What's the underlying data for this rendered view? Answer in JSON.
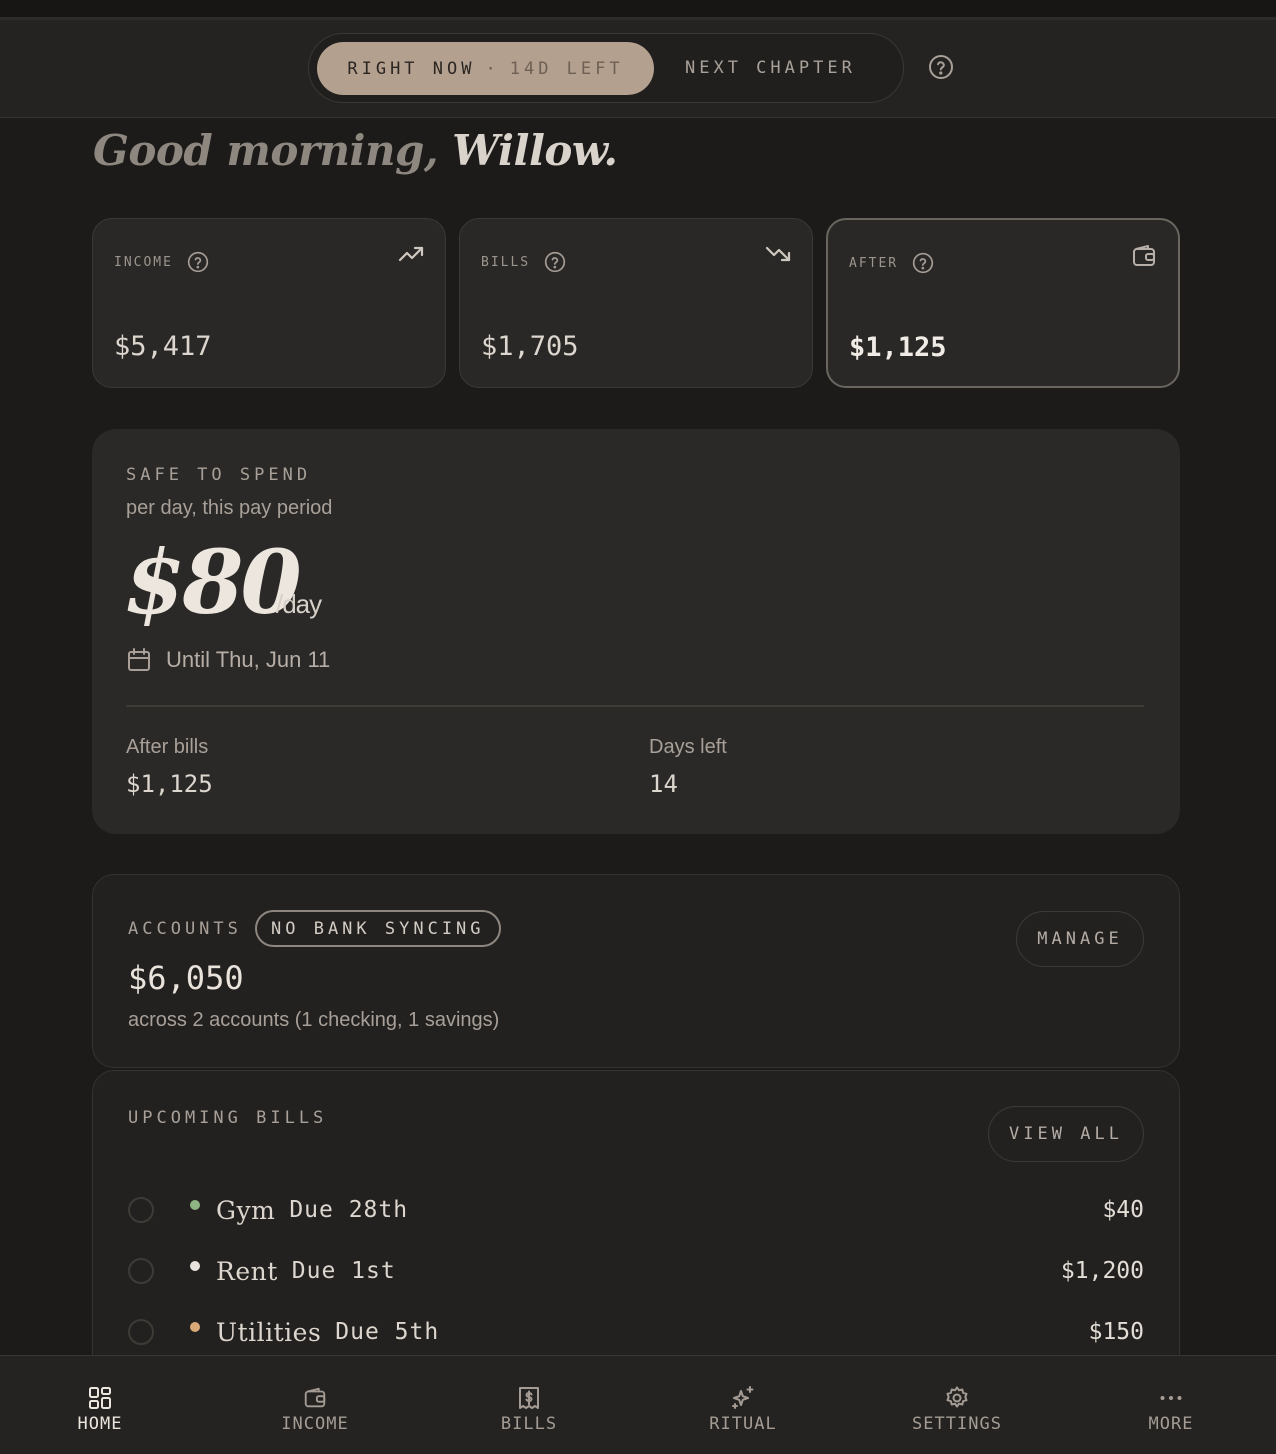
{
  "header": {
    "segment_active": "RIGHT NOW",
    "segment_separator": "·",
    "segment_days_left": "14D LEFT",
    "segment_next": "NEXT CHAPTER"
  },
  "greeting": {
    "prefix": "Good morning,",
    "name": "Willow."
  },
  "stats": [
    {
      "label": "INCOME",
      "value": "$5,417",
      "icon": "trend-up-icon"
    },
    {
      "label": "BILLS",
      "value": "$1,705",
      "icon": "trend-down-icon"
    },
    {
      "label": "AFTER",
      "value": "$1,125",
      "icon": "wallet-icon"
    }
  ],
  "safe": {
    "kicker": "SAFE TO SPEND",
    "subtitle": "per day, this pay period",
    "amount": "$80",
    "unit": "/day",
    "until": "Until Thu, Jun 11",
    "after_bills_label": "After bills",
    "after_bills_value": "$1,125",
    "days_left_label": "Days left",
    "days_left_value": "14"
  },
  "accounts": {
    "kicker": "ACCOUNTS",
    "badge": "NO BANK SYNCING",
    "total": "$6,050",
    "description": "across 2 accounts (1 checking, 1 savings)",
    "manage_label": "MANAGE"
  },
  "bills": {
    "kicker": "UPCOMING BILLS",
    "view_all_label": "VIEW ALL",
    "items": [
      {
        "name": "Gym",
        "due": "Due 28th",
        "amount": "$40",
        "dot_color": "#8fb584"
      },
      {
        "name": "Rent",
        "due": "Due 1st",
        "amount": "$1,200",
        "dot_color": "#e8e3dd"
      },
      {
        "name": "Utilities",
        "due": "Due 5th",
        "amount": "$150",
        "dot_color": "#d9a977"
      }
    ]
  },
  "nav": [
    {
      "label": "HOME",
      "icon": "grid-icon",
      "active": true
    },
    {
      "label": "INCOME",
      "icon": "wallet-icon",
      "active": false
    },
    {
      "label": "BILLS",
      "icon": "receipt-icon",
      "active": false
    },
    {
      "label": "RITUAL",
      "icon": "sparkles-icon",
      "active": false
    },
    {
      "label": "SETTINGS",
      "icon": "gear-icon",
      "active": false
    },
    {
      "label": "MORE",
      "icon": "more-icon",
      "active": false
    }
  ]
}
